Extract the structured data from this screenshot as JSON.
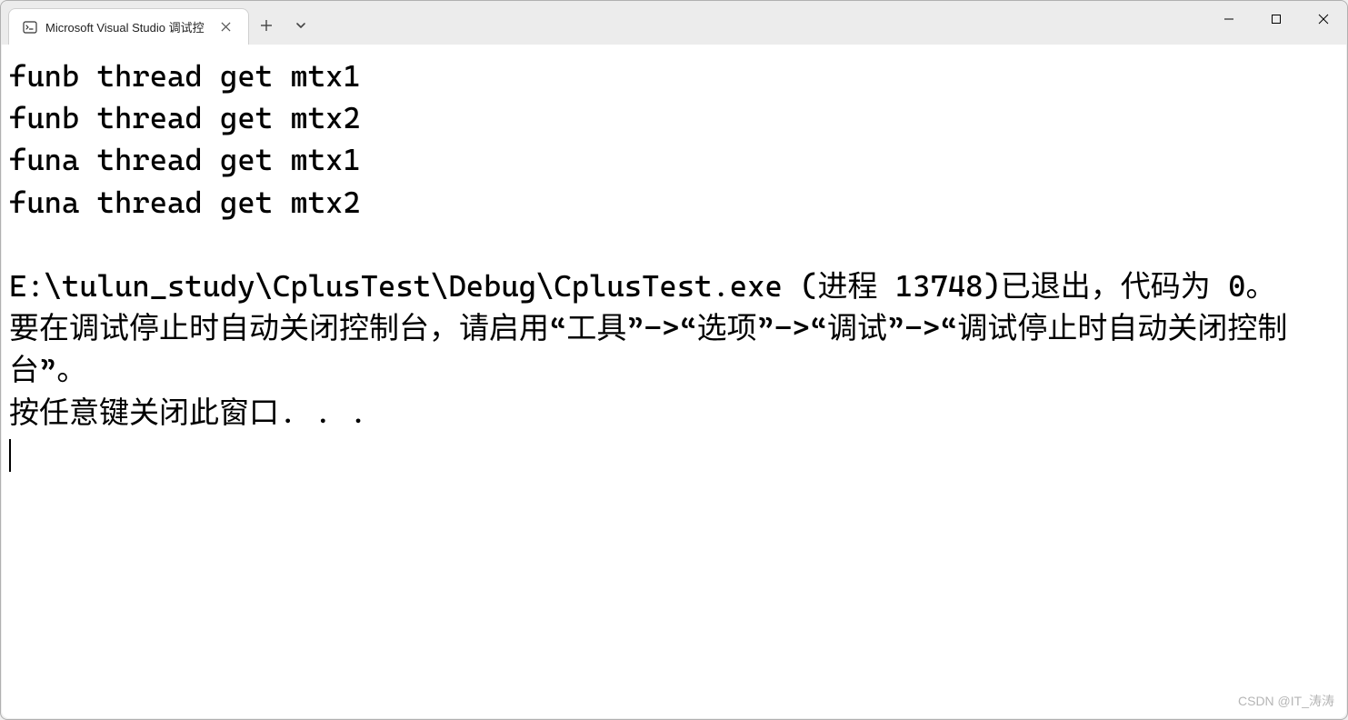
{
  "titlebar": {
    "tab_title": "Microsoft Visual Studio 调试控",
    "tab_icon": "terminal-icon",
    "new_tab_label": "+",
    "dropdown_label": "⌄"
  },
  "window_controls": {
    "minimize": "minimize",
    "maximize": "maximize",
    "close": "close"
  },
  "console": {
    "lines": [
      "funb thread get mtx1",
      "funb thread get mtx2",
      "funa thread get mtx1",
      "funa thread get mtx2",
      "",
      "E:\\tulun_study\\CplusTest\\Debug\\CplusTest.exe (进程 13748)已退出，代码为 0。",
      "要在调试停止时自动关闭控制台，请启用“工具”->“选项”->“调试”->“调试停止时自动关闭控制台”。",
      "按任意键关闭此窗口. . ."
    ]
  },
  "watermark": "CSDN @IT_涛涛"
}
